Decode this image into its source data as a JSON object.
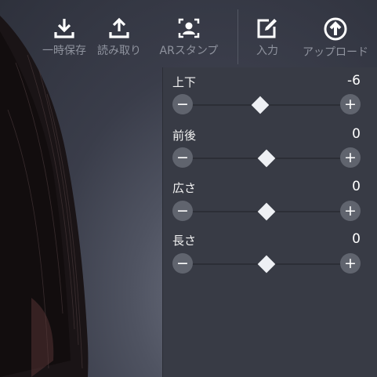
{
  "toolbar": {
    "items": [
      {
        "label": "一時保存",
        "icon": "download-icon"
      },
      {
        "label": "読み取り",
        "icon": "upload-icon"
      },
      {
        "label": "ARスタンプ",
        "icon": "ar-stamp-icon"
      },
      {
        "label": "入力",
        "icon": "edit-icon"
      },
      {
        "label": "アップロード",
        "icon": "cloud-upload-icon"
      }
    ]
  },
  "panel": {
    "rows": [
      {
        "label": "上下",
        "value": "-6",
        "level": 0.46
      },
      {
        "label": "前後",
        "value": "0",
        "level": 0.5
      },
      {
        "label": "広さ",
        "value": "0",
        "level": 0.5
      },
      {
        "label": "長さ",
        "value": "0",
        "level": 0.5
      }
    ],
    "minus_symbol": "−",
    "plus_symbol": "+"
  },
  "colors": {
    "background": "#3a3d4a",
    "panel": "#383b45",
    "thumb": "#eef0f4",
    "button": "#60646e",
    "toolbar_text": "#8f939e"
  }
}
